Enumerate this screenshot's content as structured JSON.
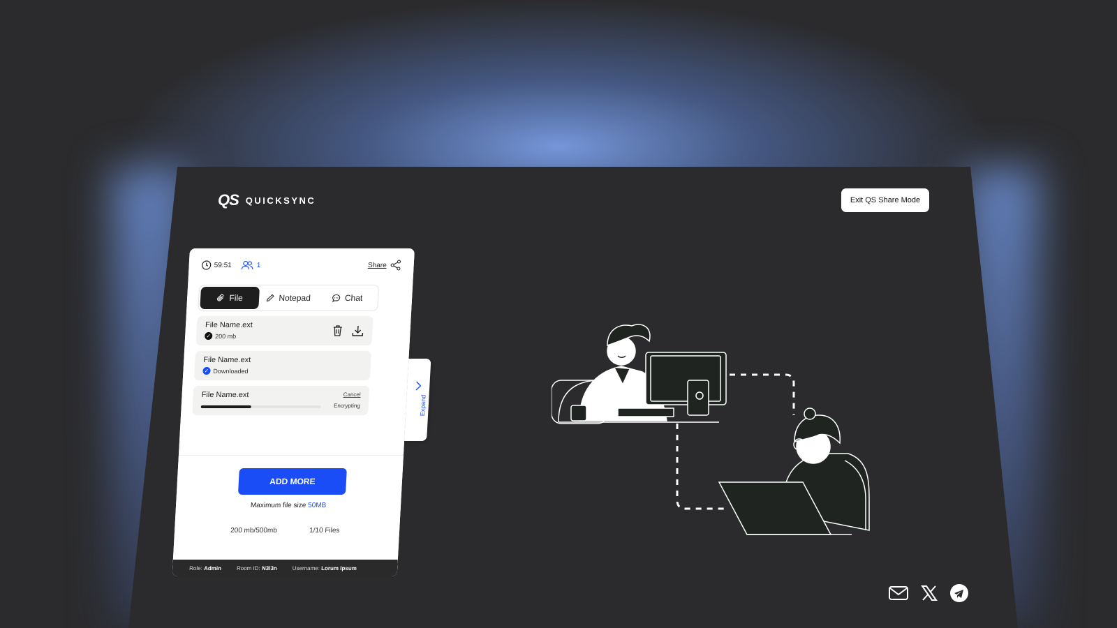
{
  "app": {
    "logo_mark": "QS",
    "name": "QUICKSYNC"
  },
  "header": {
    "exit_label": "Exit QS Share Mode"
  },
  "panel": {
    "timer": "59:51",
    "user_count": "1",
    "share_label": "Share",
    "tabs": [
      {
        "label": "File",
        "icon": "paperclip-icon",
        "active": true
      },
      {
        "label": "Notepad",
        "icon": "pencil-icon",
        "active": false
      },
      {
        "label": "Chat",
        "icon": "chat-bubble-icon",
        "active": false
      }
    ],
    "files": [
      {
        "name": "File Name.ext",
        "sub": "200 mb"
      },
      {
        "name": "File Name.ext",
        "sub": "Downloaded"
      },
      {
        "name": "File Name.ext",
        "cancel": "Cancel",
        "status": "Encrypting",
        "progress": 0.42
      }
    ],
    "expand_label": "Expand",
    "add_more_label": "ADD MORE",
    "max_size_label": "Maximum file size",
    "max_size_value": "50MB",
    "usage": "200 mb/500mb",
    "files_count": "1/10 Files",
    "footer": {
      "role_label": "Role:",
      "role_value": "Admin",
      "room_label": "Room ID:",
      "room_value": "N3l3n",
      "user_label": "Username:",
      "user_value": "Lorum Ipsum"
    }
  },
  "social": [
    "mail-icon",
    "x-icon",
    "telegram-icon"
  ],
  "colors": {
    "accent": "#1a4df5",
    "background": "#2b2b2d",
    "glow": "#7898e0"
  }
}
